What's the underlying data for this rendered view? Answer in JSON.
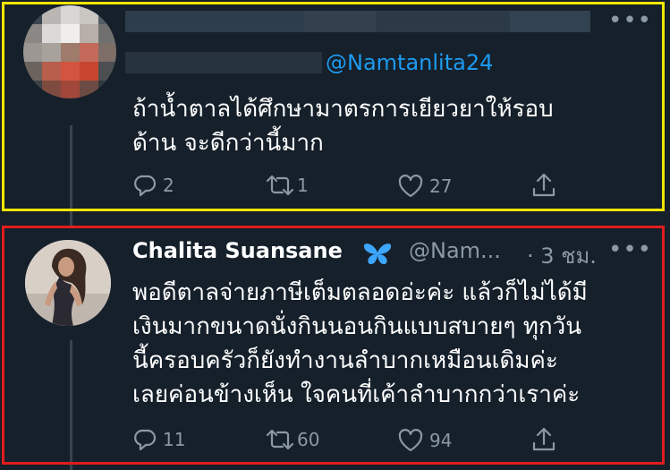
{
  "reply_tweet": {
    "handle_mention": "@Namtanlita24",
    "text_lines": [
      "ถ้าน้ำตาลได้ศึกษามาตรการเยียวยาให้รอบ",
      "ด้าน จะดีกว่านี้มาก"
    ],
    "actions": {
      "reply_count": "2",
      "retweet_count": "1",
      "like_count": "27"
    }
  },
  "main_tweet": {
    "name": "Chalita Suansane",
    "badge": "butterfly-icon",
    "handle": "@Nam...",
    "time": "· 3 ชม.",
    "text_lines": [
      "พอดีตาลจ่ายภาษีเต็มตลอดอ่ะค่ะ แล้วก็ไม่ได้มี",
      "เงินมากขนาดนั่งกินนอนกินแบบสบายๆ ทุกวัน",
      "นี้ครอบครัวก็ยังทำงานลำบากเหมือนเดิมค่ะ",
      "เลยค่อนข้างเห็น ใจคนที่เค้าลำบากกว่าเราค่ะ"
    ],
    "actions": {
      "reply_count": "11",
      "retweet_count": "60",
      "like_count": "94"
    }
  },
  "more_label": "•••",
  "colors": {
    "background": "#15202b",
    "accent": "#1d9bf0",
    "muted": "#8b98a5",
    "highlight_top": "#f2e600",
    "highlight_bottom": "#e21c1c"
  }
}
